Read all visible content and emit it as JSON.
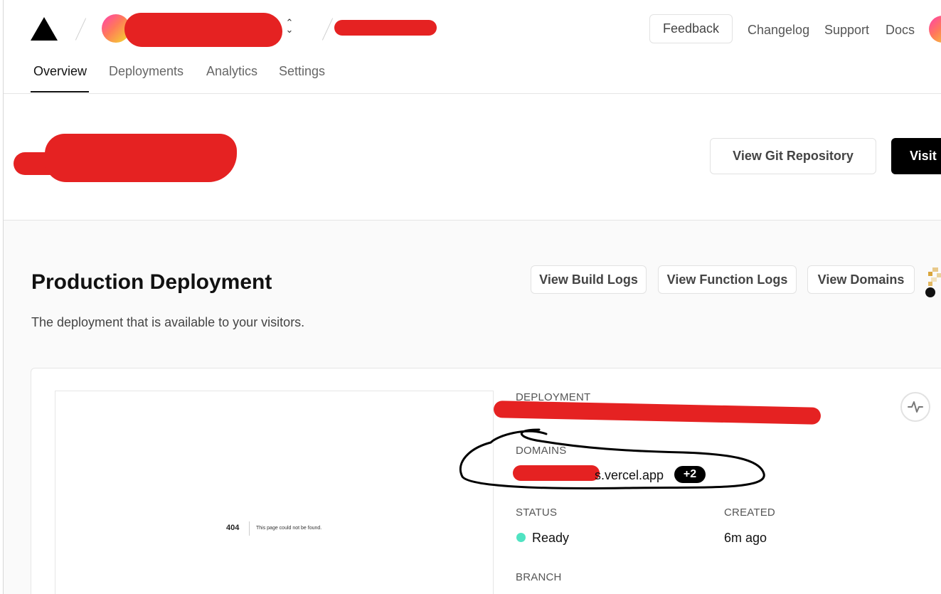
{
  "header": {
    "feedback_label": "Feedback",
    "nav": [
      "Changelog",
      "Support",
      "Docs"
    ]
  },
  "tabs": [
    "Overview",
    "Deployments",
    "Analytics",
    "Settings"
  ],
  "project": {
    "git_button": "View Git Repository",
    "visit_button": "Visit"
  },
  "production": {
    "title": "Production Deployment",
    "subtitle": "The deployment that is available to your visitors.",
    "buttons": [
      "View Build Logs",
      "View Function Logs",
      "View Domains"
    ]
  },
  "preview": {
    "code": "404",
    "message": "This page could not be found."
  },
  "details": {
    "deployment_label": "DEPLOYMENT",
    "domains_label": "DOMAINS",
    "domain_value": "s.vercel.app",
    "domains_extra": "+2",
    "status_label": "STATUS",
    "status_value": "Ready",
    "created_label": "CREATED",
    "created_value": "6m ago",
    "branch_label": "BRANCH"
  },
  "colors": {
    "accent": "#000000",
    "ready": "#50e3c2",
    "redaction": "#e52222"
  }
}
